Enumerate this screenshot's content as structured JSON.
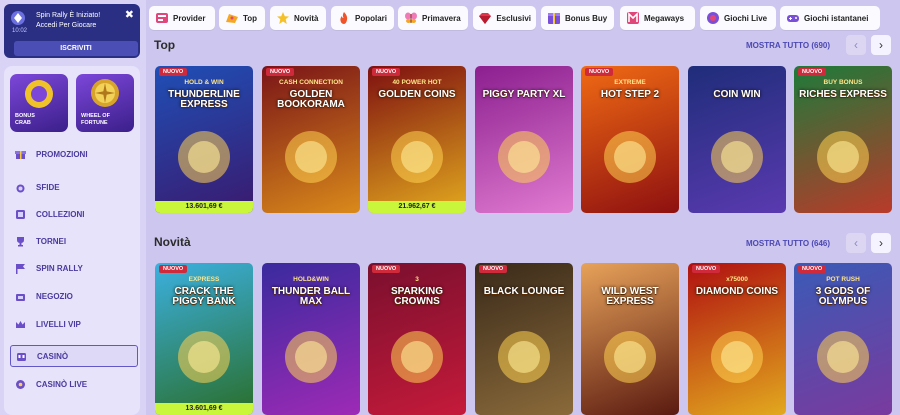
{
  "notification": {
    "time": "10:02",
    "title": "Spin Rally È Iniziato!",
    "subtitle": "Accedi Per Giocare",
    "button": "ISCRIVITI",
    "close": "✖"
  },
  "promo_tiles": [
    {
      "label_line1": "BONUS",
      "label_line2": "CRAB"
    },
    {
      "label_line1": "WHEEL OF",
      "label_line2": "FORTUNE"
    }
  ],
  "nav": [
    {
      "label": "PROMOZIONI",
      "icon": "gift-icon"
    },
    {
      "label": "SFIDE",
      "icon": "medal-icon"
    },
    {
      "label": "COLLEZIONI",
      "icon": "collection-icon"
    },
    {
      "label": "TORNEI",
      "icon": "trophy-icon"
    },
    {
      "label": "SPIN RALLY",
      "icon": "flag-icon"
    },
    {
      "label": "NEGOZIO",
      "icon": "shop-icon"
    },
    {
      "label": "LIVELLI VIP",
      "icon": "crown-icon"
    },
    {
      "label": "CASINÒ",
      "icon": "slot-icon",
      "active": true
    },
    {
      "label": "CASINÒ LIVE",
      "icon": "live-icon"
    }
  ],
  "categories": [
    {
      "label": "Provider",
      "icon": "provider-icon"
    },
    {
      "label": "Top",
      "icon": "top-icon"
    },
    {
      "label": "Novità",
      "icon": "star-icon"
    },
    {
      "label": "Popolari",
      "icon": "fire-icon"
    },
    {
      "label": "Primavera",
      "icon": "butterfly-icon"
    },
    {
      "label": "Esclusivi",
      "icon": "gem-icon"
    },
    {
      "label": "Bonus Buy",
      "icon": "bonus-buy-icon"
    },
    {
      "label": "Megaways",
      "icon": "megaways-icon"
    },
    {
      "label": "Giochi Live",
      "icon": "live-games-icon"
    },
    {
      "label": "Giochi istantanei",
      "icon": "gamepad-icon"
    }
  ],
  "sections": [
    {
      "title": "Top",
      "more": "MOSTRA TUTTO (690)",
      "games": [
        {
          "title": "THUNDERLINE EXPRESS",
          "sub": "HOLD & WIN",
          "badge": "NUOVO",
          "jackpot": "13.601,69 €",
          "bg1": "#1f4fb6",
          "bg2": "#3a1a6e"
        },
        {
          "title": "GOLDEN BOOKORAMA",
          "sub": "CASH CONNECTION",
          "badge": "NUOVO",
          "jackpot": "",
          "bg1": "#7a1418",
          "bg2": "#d98a1a"
        },
        {
          "title": "GOLDEN COINS",
          "sub": "40 POWER HOT",
          "badge": "NUOVO",
          "jackpot": "21.962,67 €",
          "bg1": "#7e1010",
          "bg2": "#e2a91e"
        },
        {
          "title": "PIGGY PARTY XL",
          "sub": "",
          "badge": "",
          "jackpot": "",
          "bg1": "#8b1f8f",
          "bg2": "#e07ad0"
        },
        {
          "title": "HOT STEP 2",
          "sub": "EXTREME",
          "badge": "NUOVO",
          "jackpot": "",
          "bg1": "#f06a14",
          "bg2": "#8e1010"
        },
        {
          "title": "COIN WIN",
          "sub": "",
          "badge": "",
          "jackpot": "",
          "bg1": "#1f2d7a",
          "bg2": "#5a3ab0"
        },
        {
          "title": "RICHES EXPRESS",
          "sub": "BUY BONUS",
          "badge": "NUOVO",
          "jackpot": "",
          "bg1": "#1d7a3a",
          "bg2": "#b93a2a"
        }
      ]
    },
    {
      "title": "Novità",
      "more": "MOSTRA TUTTO (646)",
      "games": [
        {
          "title": "CRACK THE PIGGY BANK",
          "sub": "EXPRESS",
          "badge": "NUOVO",
          "jackpot": "13.601,69 €",
          "bg1": "#3bb0e0",
          "bg2": "#2a6e2a"
        },
        {
          "title": "THUNDER BALL MAX",
          "sub": "HOLD&WIN",
          "badge": "",
          "jackpot": "",
          "bg1": "#3a2a9e",
          "bg2": "#9e2ab6"
        },
        {
          "title": "SPARKING CROWNS",
          "sub": "3",
          "badge": "NUOVO",
          "jackpot": "",
          "bg1": "#7a0f2e",
          "bg2": "#c51a3a"
        },
        {
          "title": "BLACK LOUNGE",
          "sub": "",
          "badge": "NUOVO",
          "jackpot": "",
          "bg1": "#3a2a1a",
          "bg2": "#8a6a3a"
        },
        {
          "title": "WILD WEST EXPRESS",
          "sub": "",
          "badge": "",
          "jackpot": "",
          "bg1": "#e7a25a",
          "bg2": "#5a1a10"
        },
        {
          "title": "DIAMOND COINS",
          "sub": "x75000",
          "badge": "NUOVO",
          "jackpot": "",
          "bg1": "#b01010",
          "bg2": "#e2a91e"
        },
        {
          "title": "3 GODS OF OLYMPUS",
          "sub": "POT RUSH",
          "badge": "NUOVO",
          "jackpot": "",
          "bg1": "#3a5ab6",
          "bg2": "#7a3a9e"
        }
      ]
    }
  ],
  "colors": {
    "accent": "#4b48b3",
    "jackpot": "#c9f53b",
    "badge": "#cf2a3c",
    "notif": "#2a2f83"
  }
}
